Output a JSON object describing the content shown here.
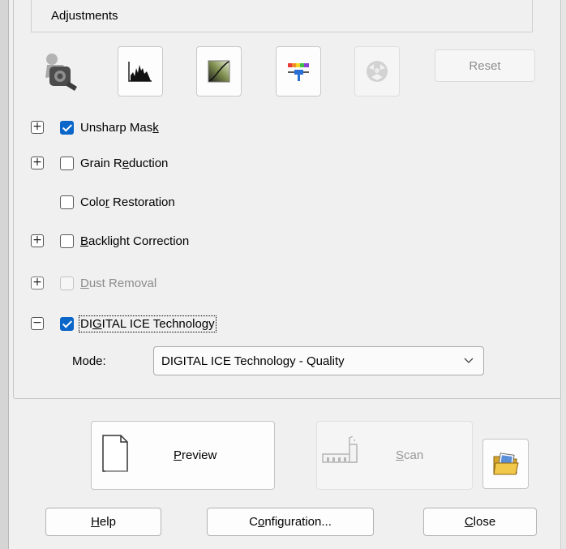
{
  "adjustments": {
    "title": "Adjustments",
    "tools": [
      {
        "icon": "auto-exposure-icon",
        "enabled": true
      },
      {
        "icon": "histogram-icon",
        "enabled": true
      },
      {
        "icon": "tone-curve-icon",
        "enabled": true
      },
      {
        "icon": "color-palette-icon",
        "enabled": true
      },
      {
        "icon": "color-balance-icon",
        "enabled": false
      }
    ],
    "reset_label": "Reset",
    "options": [
      {
        "pre": "Unsharp Mas",
        "key": "k",
        "post": "",
        "checked": true,
        "expander": "+",
        "enabled": true
      },
      {
        "pre": "Grain R",
        "key": "e",
        "post": "duction",
        "checked": false,
        "expander": "+",
        "enabled": true
      },
      {
        "pre": "Colo",
        "key": "r",
        "post": " Restoration",
        "checked": false,
        "expander": "",
        "enabled": true
      },
      {
        "pre": "",
        "key": "B",
        "post": "acklight Correction",
        "checked": false,
        "expander": "+",
        "enabled": true
      },
      {
        "pre": "",
        "key": "D",
        "post": "ust Removal",
        "checked": false,
        "expander": "+",
        "enabled": false
      },
      {
        "pre": "DI",
        "key": "G",
        "post": "ITAL ICE Technology",
        "checked": true,
        "expander": "−",
        "enabled": true
      }
    ],
    "mode": {
      "label": "Mode:",
      "value": "DIGITAL ICE Technology - Quality"
    }
  },
  "actions": {
    "preview": {
      "key": "P",
      "rest": "review"
    },
    "scan": {
      "key": "S",
      "rest": "can",
      "enabled": false
    },
    "folder_icon": "open-folder-icon"
  },
  "footer": {
    "help": {
      "key": "H",
      "rest": "elp"
    },
    "configuration": {
      "pre": "C",
      "key": "o",
      "post": "nfiguration..."
    },
    "close": {
      "key": "C",
      "rest": "lose"
    }
  }
}
